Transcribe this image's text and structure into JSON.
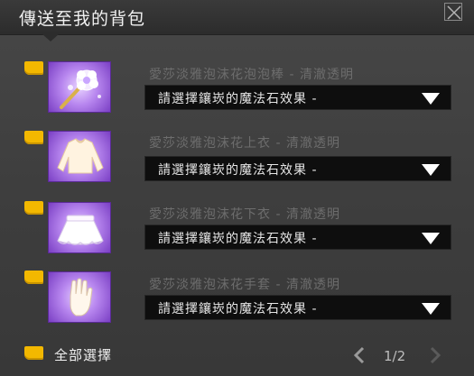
{
  "window": {
    "title": "傳送至我的背包"
  },
  "items": [
    {
      "name": "愛莎淡雅泡沫花泡泡棒 - 清澈透明",
      "select_value": "請選擇鑲崁的魔法石效果 -",
      "icon": "bubble-wand-icon"
    },
    {
      "name": "愛莎淡雅泡沫花上衣 - 清澈透明",
      "select_value": "請選擇鑲崁的魔法石效果 -",
      "icon": "top-shirt-icon"
    },
    {
      "name": "愛莎淡雅泡沫花下衣 - 清澈透明",
      "select_value": "請選擇鑲崁的魔法石效果 -",
      "icon": "skirt-icon"
    },
    {
      "name": "愛莎淡雅泡沫花手套 - 清澈透明",
      "select_value": "請選擇鑲崁的魔法石效果 -",
      "icon": "glove-icon"
    }
  ],
  "footer": {
    "select_all_label": "全部選擇",
    "page": "1/2"
  },
  "colors": {
    "checkbox": "#f3b800",
    "thumb_bg": "#a97be8",
    "select_bg": "#0e0e0e"
  }
}
